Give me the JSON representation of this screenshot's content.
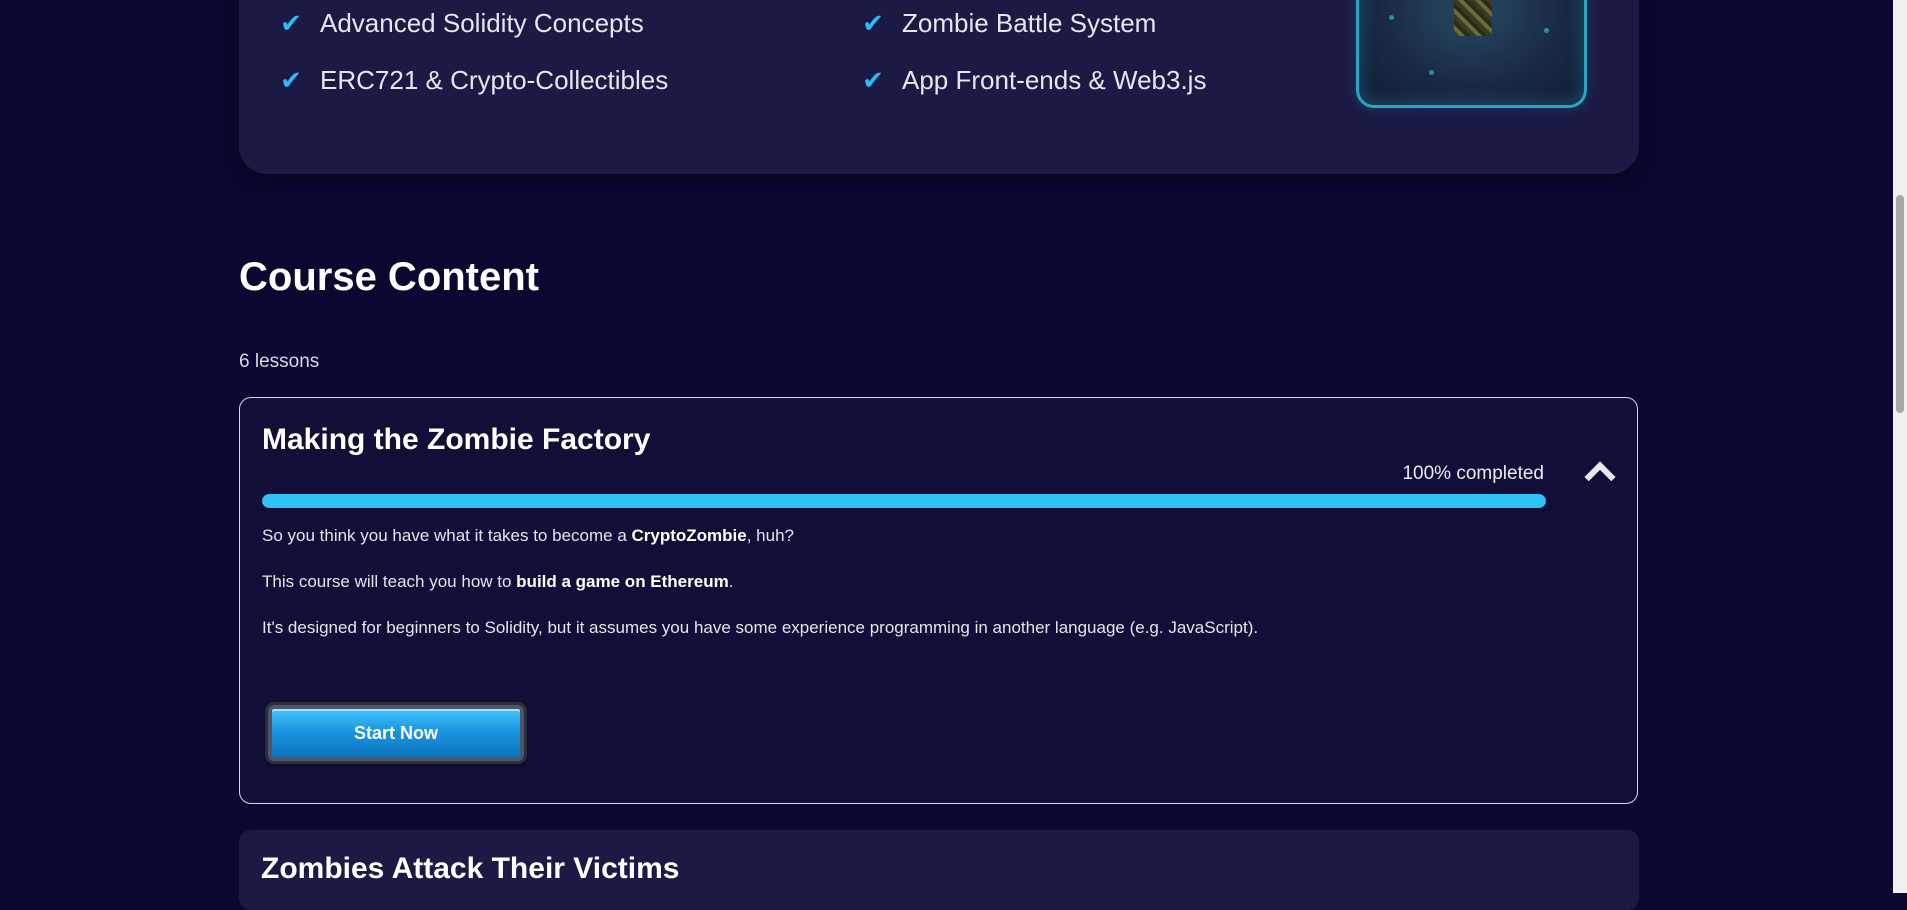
{
  "features": {
    "items": [
      {
        "label": "Advanced Solidity Concepts",
        "icon": "check-icon"
      },
      {
        "label": "Zombie Battle System",
        "icon": "check-icon"
      },
      {
        "label": "ERC721 & Crypto-Collectibles",
        "icon": "check-icon"
      },
      {
        "label": "App Front-ends & Web3.js",
        "icon": "check-icon"
      }
    ]
  },
  "course_content": {
    "title": "Course Content",
    "lessons_count": "6 lessons"
  },
  "lesson_1": {
    "title": "Making the Zombie Factory",
    "progress_text": "100% completed",
    "progress_fraction": 1.0,
    "desc1_pre": "So you think you have what it takes to become a ",
    "desc1_bold": "CryptoZombie",
    "desc1_post": ", huh?",
    "desc2_pre": "This course will teach you how to ",
    "desc2_bold": "build a game on Ethereum",
    "desc2_post": ".",
    "desc3": "It's designed for beginners to Solidity, but it assumes you have some experience programming in another language (e.g. JavaScript).",
    "start_label": "Start Now"
  },
  "lesson_2": {
    "title": "Zombies Attack Their Victims"
  },
  "colors": {
    "background": "#0a0730",
    "card": "#1b1a45",
    "accent": "#2fc0f5"
  }
}
